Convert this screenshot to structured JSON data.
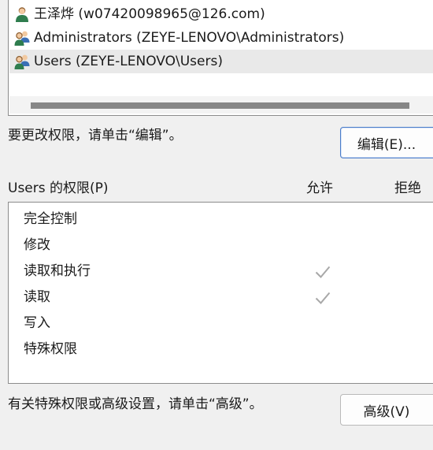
{
  "principals": [
    {
      "icon": "user-icon",
      "label": "王泽烨 (w07420098965@126.com)",
      "selected": false
    },
    {
      "icon": "group-icon",
      "label": "Administrators (ZEYE-LENOVO\\Administrators)",
      "selected": false
    },
    {
      "icon": "group-icon",
      "label": "Users (ZEYE-LENOVO\\Users)",
      "selected": true
    }
  ],
  "edit_hint": "要更改权限，请单击“编辑”。",
  "edit_button": "编辑(E)...",
  "permissions_header": {
    "name": "Users 的权限(P)",
    "allow": "允许",
    "deny": "拒绝"
  },
  "permissions": [
    {
      "name": "完全控制",
      "allow": false,
      "deny": false
    },
    {
      "name": "修改",
      "allow": false,
      "deny": false
    },
    {
      "name": "读取和执行",
      "allow": true,
      "deny": false
    },
    {
      "name": "读取",
      "allow": true,
      "deny": false
    },
    {
      "name": "写入",
      "allow": false,
      "deny": false
    },
    {
      "name": "特殊权限",
      "allow": false,
      "deny": false
    }
  ],
  "advanced_hint": "有关特殊权限或高级设置，请单击“高级”。",
  "advanced_button": "高级(V)",
  "colors": {
    "check": "#a8a8a8",
    "selection": "#e9e9e9",
    "focus_border": "#4a7cc9"
  }
}
